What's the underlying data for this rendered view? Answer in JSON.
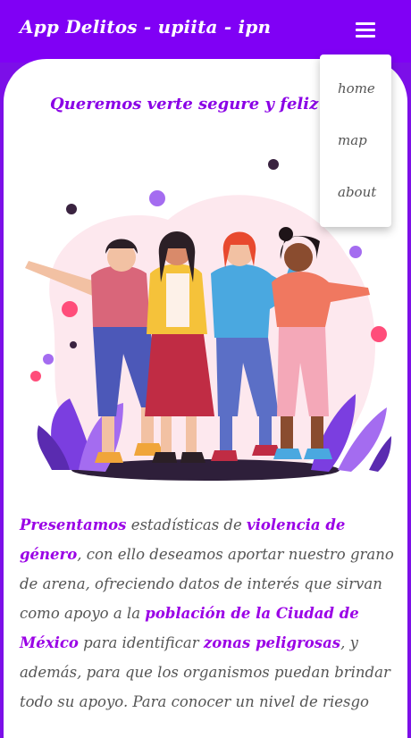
{
  "appbar": {
    "title": "App Delitos - upiita - ipn",
    "menu_icon": "hamburger-menu-icon"
  },
  "main": {
    "tagline": "Queremos verte segure y feliz sie",
    "hero_image": "group-of-women-illustration",
    "intro": {
      "t1": "Presentamos",
      "t2": " estadísticas de ",
      "t3": "violencia de género",
      "t4": ", con ello deseamos aportar nuestro grano de arena, ofreciendo datos de interés que sirvan como apoyo a la ",
      "t5": "población de la Ciudad de México",
      "t6": " para identificar ",
      "t7": "zonas peligrosas",
      "t8": ", y además, para que los organismos puedan brindar todo su apoyo. Para conocer un nivel de riesgo"
    }
  },
  "dropdown": {
    "items": [
      {
        "label": "home"
      },
      {
        "label": "map"
      },
      {
        "label": "about"
      }
    ]
  },
  "colors": {
    "primary": "#8000f5",
    "highlight": "#9a00e6",
    "text": "#555555"
  }
}
